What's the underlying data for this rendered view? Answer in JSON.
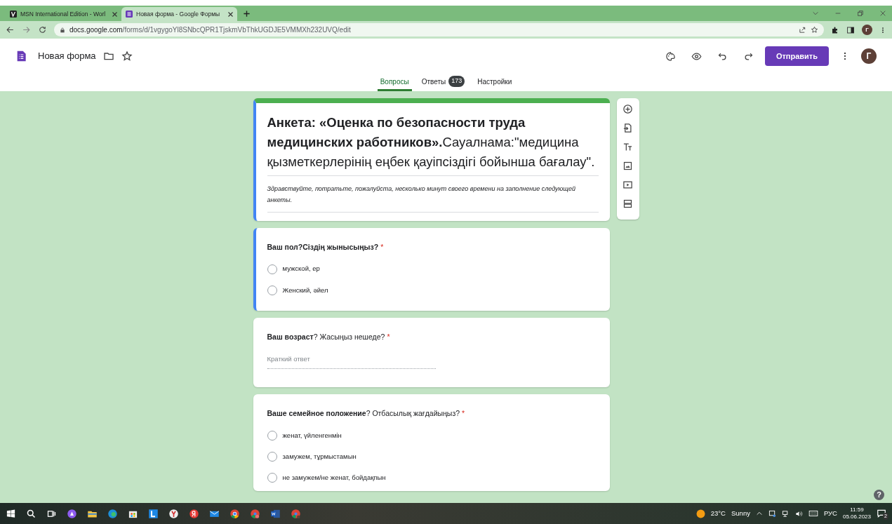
{
  "browser": {
    "tabs": [
      {
        "title": "MSN International Edition - Worl",
        "selected": false
      },
      {
        "title": "Новая форма - Google Формы",
        "selected": true
      }
    ],
    "url": {
      "host": "docs.google.com",
      "path": "/forms/d/1vgygoYl8SNbcQPR1TjskmVbThkUGDJE5VMMXh232UVQ/edit"
    },
    "profile_initial": "Г"
  },
  "app_bar": {
    "title": "Новая форма",
    "send_button": "Отправить",
    "avatar_initial": "Г"
  },
  "nav_tabs": [
    {
      "label": "Вопросы",
      "selected": true
    },
    {
      "label": "Ответы",
      "selected": false,
      "badge": "173"
    },
    {
      "label": "Настройки",
      "selected": false
    }
  ],
  "form": {
    "focused": true,
    "title": "**Анкета: «Оценка по безопасности труда медицинских работников».**Сауалнама:\"медицина қызметкерлерінің еңбек қауіпсіздігі бойынша бағалау\".",
    "description": "Здравствуйте, потратьте, пожалуйста, несколько минут своего времени на заполнение следующей анкеты."
  },
  "questions": [
    {
      "kind": "radio",
      "focused": true,
      "bold": true,
      "title": "Ваш пол?Сіздің жынысыңыз?",
      "required_mark": "*",
      "options": [
        {
          "label": "мужской, ер",
          "checked": false
        },
        {
          "label": "Женский, әйел",
          "checked": false
        }
      ]
    },
    {
      "kind": "short",
      "focused": false,
      "bold": false,
      "title": "**Ваш возраст**? Жасыңыз нешеде?",
      "required_mark": "*",
      "placeholder": "Краткий ответ"
    },
    {
      "kind": "radio",
      "focused": false,
      "bold": false,
      "title": "**Ваше семейное положение**? Отбасылық жағдайыңыз?",
      "required_mark": "*",
      "options": [
        {
          "label": "женат, үйленгенмін",
          "checked": false
        },
        {
          "label": "замужем, тұрмыстамын",
          "checked": false
        },
        {
          "label": "не замужем/не женат, бойдақпын",
          "checked": false
        }
      ]
    }
  ],
  "help_label": "?",
  "taskbar": {
    "temperature": "23°C",
    "weather": "Sunny",
    "language": "РУС",
    "time": "11:59",
    "date": "05.06.2023",
    "notifications": "2"
  }
}
